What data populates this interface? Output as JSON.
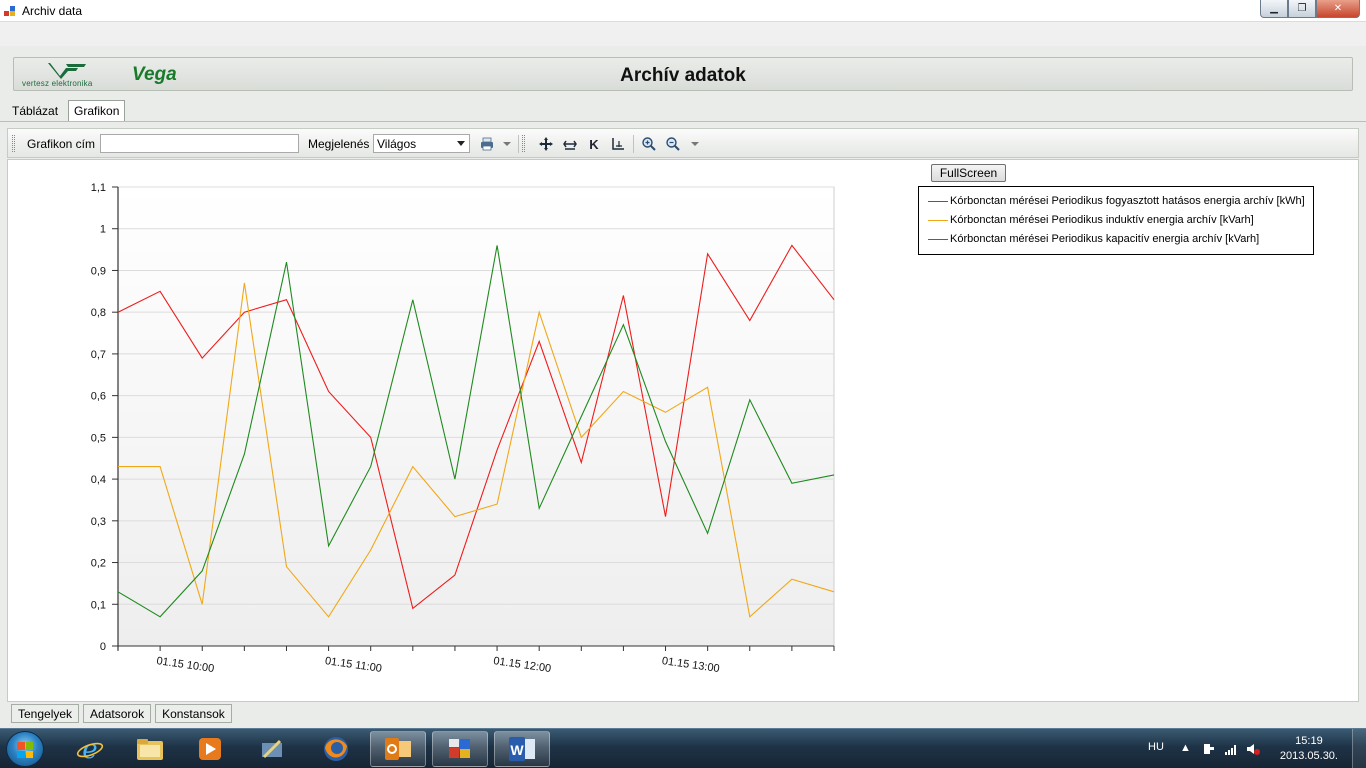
{
  "window": {
    "title": "Archiv data",
    "controls": {
      "minimize": "▁",
      "maximize": "❐",
      "close": "✕"
    }
  },
  "header": {
    "logo_text": "vertesz elektronika",
    "brand": "Vega",
    "title": "Archív adatok"
  },
  "tabs_top": [
    {
      "label": "Táblázat",
      "active": false
    },
    {
      "label": "Grafikon",
      "active": true
    }
  ],
  "toolbar": {
    "title_label": "Grafikon cím",
    "title_value": "",
    "appearance_label": "Megjelenés",
    "appearance_value": "Világos",
    "icons": [
      "print-icon",
      "pan-icon",
      "zoom-fit-icon",
      "k-icon",
      "axis-icon",
      "zoom-in-icon",
      "zoom-out-icon"
    ]
  },
  "fullscreen_label": "FullScreen",
  "chart_data": {
    "type": "line",
    "x": [
      "01.15 09:45",
      "01.15 10:00",
      "01.15 10:15",
      "01.15 10:30",
      "01.15 10:45",
      "01.15 11:00",
      "01.15 11:15",
      "01.15 11:30",
      "01.15 11:45",
      "01.15 12:00",
      "01.15 12:15",
      "01.15 12:30",
      "01.15 12:45",
      "01.15 13:00",
      "01.15 13:15",
      "01.15 13:30",
      "01.15 13:45",
      "01.15 14:00"
    ],
    "x_tick_labels": [
      "01.15 10:00",
      "01.15 11:00",
      "01.15 12:00",
      "01.15 13:00"
    ],
    "ylim": [
      0,
      1.1
    ],
    "y_ticks": [
      "0",
      "0,1",
      "0,2",
      "0,3",
      "0,4",
      "0,5",
      "0,6",
      "0,7",
      "0,8",
      "0,9",
      "1",
      "1,1"
    ],
    "grid": true,
    "legend_position": "top-right",
    "series": [
      {
        "name": "Kórbonctan mérései Periodikus fogyasztott hatásos energia archív [kWh]",
        "color": "#ee1c1c",
        "values": [
          0.8,
          0.85,
          0.69,
          0.8,
          0.83,
          0.61,
          0.5,
          0.09,
          0.17,
          0.47,
          0.73,
          0.44,
          0.84,
          0.31,
          0.94,
          0.78,
          0.96,
          0.83
        ]
      },
      {
        "name": "Kórbonctan mérései Periodikus induktív energia archív [kVarh]",
        "color": "#f0a818",
        "values": [
          0.43,
          0.43,
          0.1,
          0.87,
          0.19,
          0.07,
          0.23,
          0.43,
          0.31,
          0.34,
          0.8,
          0.5,
          0.61,
          0.56,
          0.62,
          0.07,
          0.16,
          0.13
        ]
      },
      {
        "name": "Kórbonctan mérései Periodikus kapacitív energia archív [kVarh]",
        "color": "#1f8a1f",
        "values": [
          0.13,
          0.07,
          0.18,
          0.46,
          0.92,
          0.24,
          0.43,
          0.83,
          0.4,
          0.96,
          0.33,
          0.55,
          0.77,
          0.49,
          0.27,
          0.59,
          0.39,
          0.41
        ]
      }
    ]
  },
  "tabs_bottom": [
    "Tengelyek",
    "Adatsorok",
    "Konstansok"
  ],
  "taskbar": {
    "language": "HU",
    "time": "15:19",
    "date": "2013.05.30."
  }
}
